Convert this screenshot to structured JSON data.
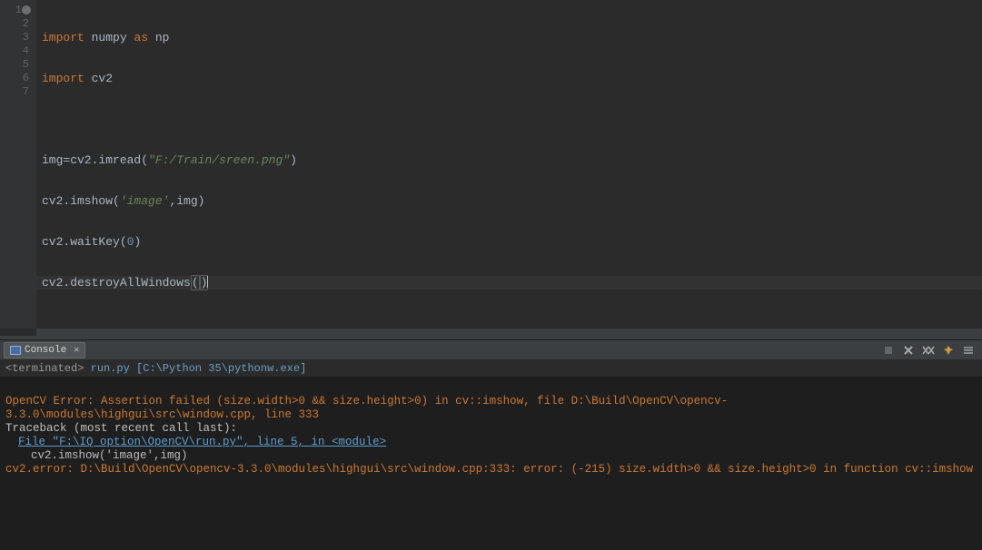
{
  "editor": {
    "lines": [
      {
        "num": 1,
        "marker": true
      },
      {
        "num": 2
      },
      {
        "num": 3
      },
      {
        "num": 4
      },
      {
        "num": 5
      },
      {
        "num": 6
      },
      {
        "num": 7,
        "highlighted": true
      }
    ],
    "code": {
      "l1_kw1": "import",
      "l1_mod": "numpy",
      "l1_kw2": "as",
      "l1_alias": "np",
      "l2_kw": "import",
      "l2_mod": "cv2",
      "l4_var": "img=cv2.imread(",
      "l4_str": "\"F:/Train/sreen.png\"",
      "l4_end": ")",
      "l5_call": "cv2.imshow(",
      "l5_str": "'image'",
      "l5_mid": ",img)",
      "l6_call": "cv2.waitKey(",
      "l6_num": "0",
      "l6_end": ")",
      "l7_call": "cv2.destroyAllWindows",
      "l7_paren_open": "(",
      "l7_paren_close": ")"
    }
  },
  "console": {
    "tab_label": "Console",
    "subheader_prefix": "<terminated>",
    "subheader_file": "run.py",
    "subheader_path": "[C:\\Python 35\\pythonw.exe]",
    "out1": "OpenCV Error: Assertion failed (size.width>0 && size.height>0) in cv::imshow, file D:\\Build\\OpenCV\\opencv-3.3.0\\modules\\highgui\\src\\window.cpp, line 333",
    "out2": "Traceback (most recent call last):",
    "out3": "File \"F:\\IQ option\\OpenCV\\run.py\", line 5, in <module>",
    "out4": "cv2.imshow('image',img)",
    "out5": "cv2.error: D:\\Build\\OpenCV\\opencv-3.3.0\\modules\\highgui\\src\\window.cpp:333: error: (-215) size.width>0 && size.height>0 in function cv::imshow"
  }
}
